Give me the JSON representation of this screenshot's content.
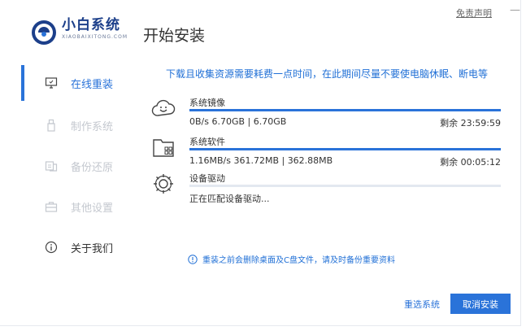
{
  "header": {
    "brand_name": "小白系统",
    "brand_sub": "XIAOBAIXITONG.COM",
    "page_title": "开始安装",
    "disclaimer": "免责声明",
    "minimize": "—"
  },
  "sidebar": {
    "items": [
      {
        "label": "在线重装",
        "icon": "monitor-icon",
        "state": "active"
      },
      {
        "label": "制作系统",
        "icon": "usb-icon",
        "state": "disabled"
      },
      {
        "label": "备份还原",
        "icon": "backup-icon",
        "state": "disabled"
      },
      {
        "label": "其他设置",
        "icon": "briefcase-icon",
        "state": "disabled"
      },
      {
        "label": "关于我们",
        "icon": "info-icon",
        "state": "normal"
      }
    ]
  },
  "notice": "下载且收集资源需要耗费一点时间，在此期间尽量不要使电脑休眠、断电等",
  "tasks": [
    {
      "name": "系统镜像",
      "icon": "cloud-smile-icon",
      "speed": "0B/s 6.70GB | 6.70GB",
      "remaining": "剩余 23:59:59",
      "progress": 1.0
    },
    {
      "name": "系统软件",
      "icon": "app-folder-icon",
      "speed": "1.16MB/s 361.72MB | 362.88MB",
      "remaining": "剩余 00:05:12",
      "progress": 1.0
    },
    {
      "name": "设备驱动",
      "icon": "gear-icon",
      "speed": "正在匹配设备驱动...",
      "remaining": "",
      "progress": 0
    }
  ],
  "tip": "重装之前会删除桌面及C盘文件，请及时备份重要资料",
  "footer": {
    "reselect": "重选系统",
    "cancel": "取消安装"
  },
  "colors": {
    "accent": "#2a73d9",
    "brand": "#1c3f8a",
    "disabled": "#c4c8cf"
  }
}
